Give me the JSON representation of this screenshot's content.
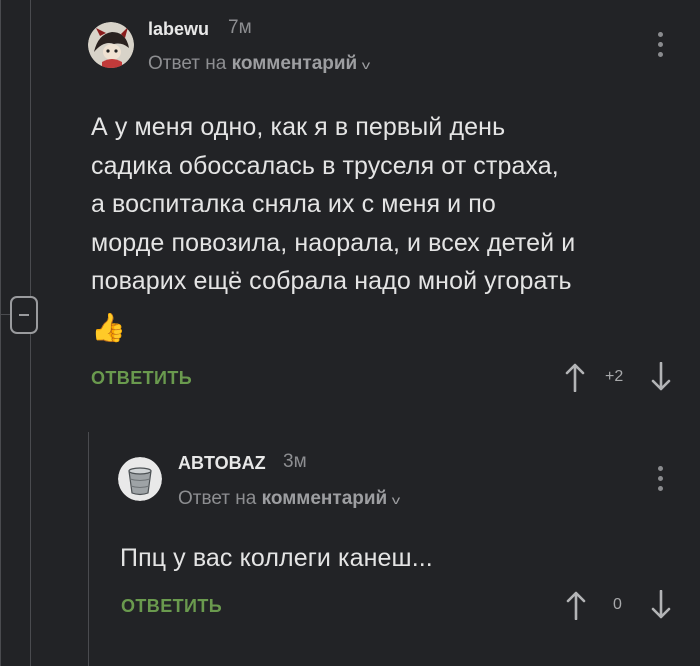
{
  "comments": [
    {
      "username": "labewu",
      "time": "7м",
      "reply_prefix": "Ответ на",
      "reply_target": "комментарий",
      "body_lines": [
        "А у меня одно, как я в первый день",
        "садика обоссалась в труселя от страха,",
        "а воспиталка сняла их с меня и по",
        "морде повозила, наорала, и всех детей и",
        "поварих ещё собрала надо мной угорать"
      ],
      "emoji": "👍",
      "reply_label": "ОТВЕТИТЬ",
      "score": "+2"
    },
    {
      "username": "ABTOBAZ",
      "time": "3м",
      "reply_prefix": "Ответ на",
      "reply_target": "комментарий",
      "body_lines": [
        "Ппц у вас коллеги канеш..."
      ],
      "reply_label": "ОТВЕТИТЬ",
      "score": "0"
    }
  ],
  "icons": {
    "upvote": "arrow-up-icon",
    "downvote": "arrow-down-icon",
    "more": "more-vertical-icon",
    "collapse": "minus-icon",
    "expand": "chevron-down-icon"
  },
  "colors": {
    "background": "#222326",
    "accent_green": "#6a9a4e",
    "muted_text": "#8d8e91",
    "thread_line": "#4a4b4f"
  }
}
